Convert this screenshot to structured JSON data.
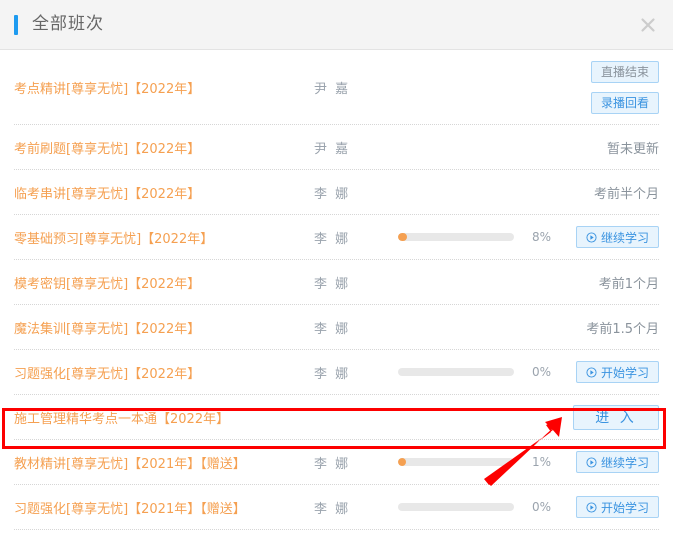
{
  "header": {
    "title": "全部班次",
    "close_icon": "close-icon",
    "accent_color": "#1e9bf0"
  },
  "colors": {
    "course_name": "#f5a051",
    "progress_fill": "#f5a051",
    "button_text": "#3a93e0",
    "button_bg": "#e8f4fd",
    "annotation": "#fd0000"
  },
  "rows": [
    {
      "name": "考点精讲[尊享无忧]【2022年】",
      "teacher": "尹  嘉",
      "progress": null,
      "percent": "",
      "status": "",
      "buttons": [
        {
          "label": "直播结束",
          "style": "muted",
          "icon": ""
        },
        {
          "label": "录播回看",
          "style": "primary",
          "icon": ""
        }
      ],
      "highlighted": false
    },
    {
      "name": "考前刷题[尊享无忧]【2022年】",
      "teacher": "尹  嘉",
      "progress": null,
      "percent": "",
      "status": "暂未更新",
      "buttons": [],
      "highlighted": false
    },
    {
      "name": "临考串讲[尊享无忧]【2022年】",
      "teacher": "李  娜",
      "progress": null,
      "percent": "",
      "status": "考前半个月",
      "buttons": [],
      "highlighted": false
    },
    {
      "name": "零基础预习[尊享无忧]【2022年】",
      "teacher": "李  娜",
      "progress": 8,
      "percent": "8%",
      "status": "",
      "buttons": [
        {
          "label": "继续学习",
          "style": "primary",
          "icon": "play-circle-icon"
        }
      ],
      "highlighted": false
    },
    {
      "name": "模考密钥[尊享无忧]【2022年】",
      "teacher": "李  娜",
      "progress": null,
      "percent": "",
      "status": "考前1个月",
      "buttons": [],
      "highlighted": false
    },
    {
      "name": "魔法集训[尊享无忧]【2022年】",
      "teacher": "李  娜",
      "progress": null,
      "percent": "",
      "status": "考前1.5个月",
      "buttons": [],
      "highlighted": false
    },
    {
      "name": "习题强化[尊享无忧]【2022年】",
      "teacher": "李  娜",
      "progress": 0,
      "percent": "0%",
      "status": "",
      "buttons": [
        {
          "label": "开始学习",
          "style": "primary",
          "icon": "play-circle-icon"
        }
      ],
      "highlighted": false
    },
    {
      "name": "施工管理精华考点一本通【2022年】",
      "teacher": "",
      "progress": null,
      "percent": "",
      "status": "",
      "buttons": [
        {
          "label": "进 入",
          "style": "enter",
          "icon": ""
        }
      ],
      "highlighted": true
    },
    {
      "name": "教材精讲[尊享无忧]【2021年】【赠送】",
      "teacher": "李  娜",
      "progress": 1,
      "percent": "1%",
      "status": "",
      "buttons": [
        {
          "label": "继续学习",
          "style": "primary",
          "icon": "play-circle-icon"
        }
      ],
      "highlighted": false
    },
    {
      "name": "习题强化[尊享无忧]【2021年】【赠送】",
      "teacher": "李  娜",
      "progress": 0,
      "percent": "0%",
      "status": "",
      "buttons": [
        {
          "label": "开始学习",
          "style": "primary",
          "icon": "play-circle-icon"
        }
      ],
      "highlighted": false
    }
  ]
}
